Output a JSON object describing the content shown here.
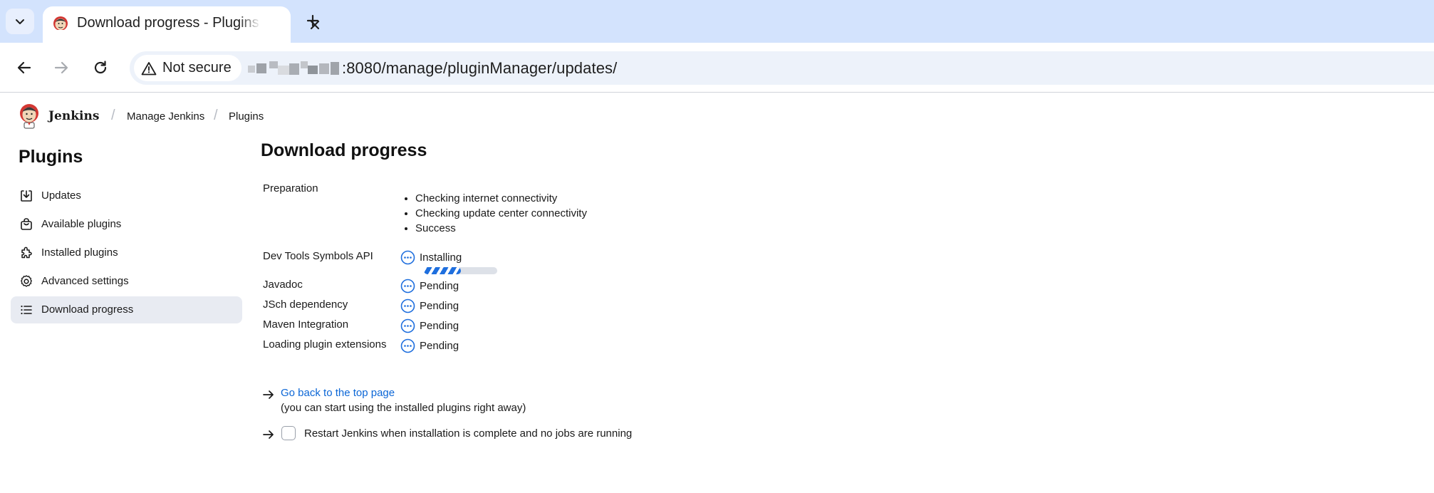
{
  "browser": {
    "tab_title": "Download progress - Plugins",
    "security_label": "Not secure",
    "url_visible": ":8080/manage/pluginManager/updates/"
  },
  "header": {
    "brand": "Jenkins",
    "breadcrumbs": [
      "Manage Jenkins",
      "Plugins"
    ]
  },
  "sidebar": {
    "title": "Plugins",
    "items": [
      {
        "label": "Updates",
        "icon": "download-icon"
      },
      {
        "label": "Available plugins",
        "icon": "shopping-bag-icon"
      },
      {
        "label": "Installed plugins",
        "icon": "puzzle-icon"
      },
      {
        "label": "Advanced settings",
        "icon": "gear-icon"
      },
      {
        "label": "Download progress",
        "icon": "list-icon",
        "active": true
      }
    ]
  },
  "main": {
    "title": "Download progress",
    "preparation": {
      "label": "Preparation",
      "steps": [
        "Checking internet connectivity",
        "Checking update center connectivity",
        "Success"
      ]
    },
    "plugins": [
      {
        "name": "Dev Tools Symbols API",
        "status": "Installing",
        "progress": 0.5
      },
      {
        "name": "Javadoc",
        "status": "Pending"
      },
      {
        "name": "JSch dependency",
        "status": "Pending"
      },
      {
        "name": "Maven Integration",
        "status": "Pending"
      },
      {
        "name": "Loading plugin extensions",
        "status": "Pending"
      }
    ],
    "back_link": "Go back to the top page",
    "back_note": "(you can start using the installed plugins right away)",
    "restart_label": "Restart Jenkins when installation is complete and no jobs are running",
    "restart_checked": false
  },
  "colors": {
    "accent": "#0b66d6",
    "tabbar": "#d3e3fd",
    "active_item": "#e8ebf2"
  }
}
